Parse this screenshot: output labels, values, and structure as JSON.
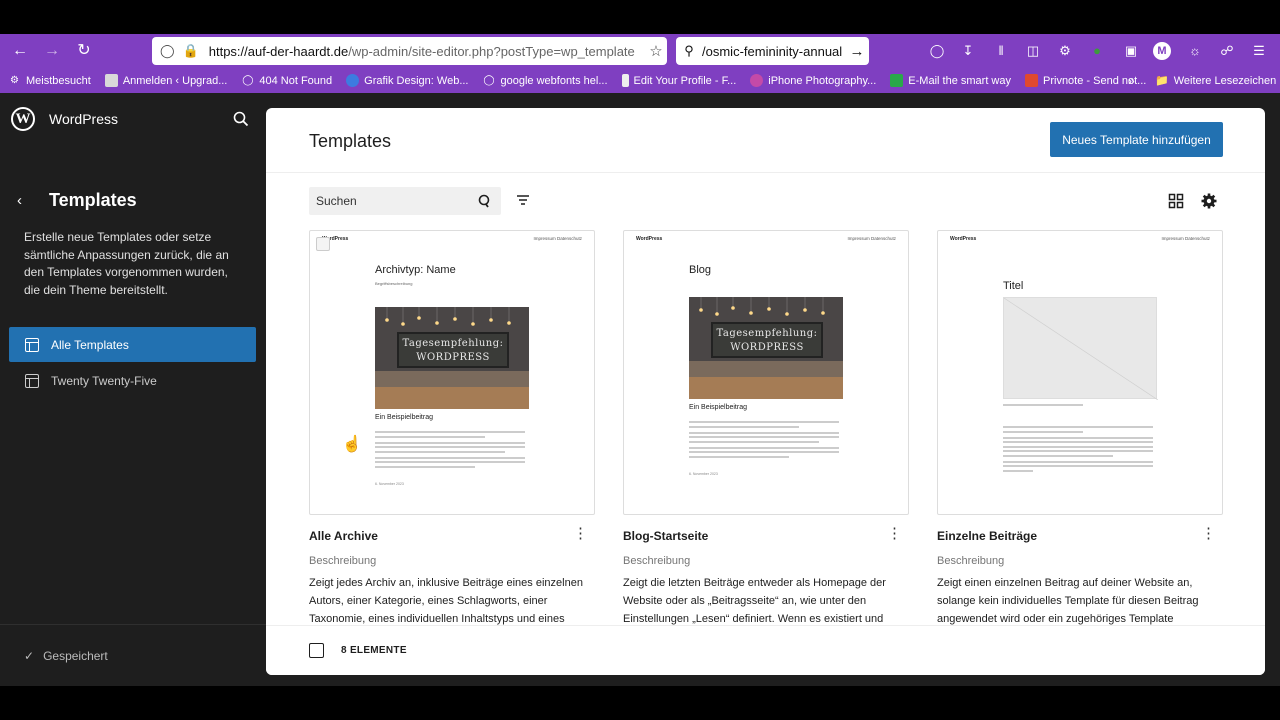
{
  "browser": {
    "url_host": "https://auf-der-haardt.de",
    "url_path": "/wp-admin/site-editor.php?postType=wp_template",
    "search_text": "osmic-femininity-annual/",
    "bookmarks": [
      {
        "label": "Meistbesucht",
        "icon": "gear-icon"
      },
      {
        "label": "Anmelden ‹ Upgrad...",
        "icon": "site-icon"
      },
      {
        "label": "404 Not Found",
        "icon": "globe-icon"
      },
      {
        "label": "Grafik Design: Web...",
        "icon": "site-icon"
      },
      {
        "label": "google webfonts hel...",
        "icon": "globe-icon"
      },
      {
        "label": "Edit Your Profile - F...",
        "icon": "site-icon"
      },
      {
        "label": "iPhone Photography...",
        "icon": "site-icon"
      },
      {
        "label": "E-Mail the smart way",
        "icon": "mail-icon"
      },
      {
        "label": "Privnote - Send not...",
        "icon": "site-icon"
      }
    ],
    "more_bookmarks": "Weitere Lesezeichen"
  },
  "sidebar": {
    "brand": "WordPress",
    "title": "Templates",
    "description": "Erstelle neue Templates oder setze sämtliche Anpassungen zurück, die an den Templates vorgenommen wurden, die dein Theme bereitstellt.",
    "nav": [
      {
        "label": "Alle Templates",
        "active": true
      },
      {
        "label": "Twenty Twenty-Five",
        "active": false
      }
    ],
    "status": "Gespeichert"
  },
  "main": {
    "title": "Templates",
    "add_button": "Neues Template hinzufügen",
    "search_placeholder": "Suchen",
    "footer_count": "8 ELEMENTE",
    "cards": [
      {
        "title": "Alle Archive",
        "desc_label": "Beschreibung",
        "desc": "Zeigt jedes Archiv an, inklusive Beiträge eines einzelnen Autors, einer Kategorie, eines Schlagworts, einer Taxonomie, eines individuellen Inhaltstyps und eines",
        "preview": {
          "brand": "WordPress",
          "nav": "Impressum   Datenschutz",
          "heading": "Archivtyp: Name",
          "sub": "Begriffsbeschreibung",
          "board": "Tagesempfehlung: WORDPRESS",
          "post": "Ein Beispielbeitrag",
          "date": "6. November 2023"
        }
      },
      {
        "title": "Blog-Startseite",
        "desc_label": "Beschreibung",
        "desc": "Zeigt die letzten Beiträge entweder als Homepage der Website oder als „Beitragsseite“ an, wie unter den Einstellungen „Lesen“ definiert. Wenn es existiert und",
        "preview": {
          "brand": "WordPress",
          "nav": "Impressum   Datenschutz",
          "heading": "Blog",
          "board": "Tagesempfehlung: WORDPRESS",
          "post": "Ein Beispielbeitrag",
          "date": "6. November 2023"
        }
      },
      {
        "title": "Einzelne Beiträge",
        "desc_label": "Beschreibung",
        "desc": "Zeigt einen einzelnen Beitrag auf deiner Website an, solange kein individuelles Template für diesen Beitrag angewendet wird oder ein zugehöriges Template",
        "preview": {
          "brand": "WordPress",
          "nav": "Impressum   Datenschutz",
          "heading": "Titel"
        }
      }
    ]
  },
  "colors": {
    "accent": "#2271b1",
    "browser": "#7f3fc1",
    "sidebar": "#1e1e1e"
  }
}
